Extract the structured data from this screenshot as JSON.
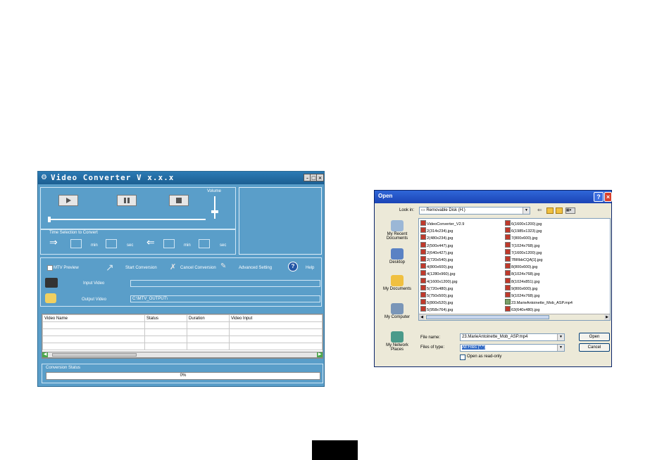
{
  "video_converter": {
    "title": "Video Converter  V x.x.x",
    "volume_label": "Volume",
    "time_section_label": "Time Selection to Convert",
    "start_arrow": "⇒",
    "end_arrow": "⇐",
    "min_label": "min",
    "sec_label": "sec",
    "mtv_preview": "MTV Preview",
    "start_conversion": "Start Conversion",
    "cancel_conversion": "Cancel Conversion",
    "advanced_setting": "Advanced Setting",
    "help": "Help",
    "input_video_label": "Input Video",
    "input_video_value": "",
    "output_video_label": "Output Video",
    "output_video_value": "C:\\MTV_OUTPUT\\",
    "columns": [
      "Video Name",
      "Status",
      "Duration",
      "Video Input"
    ],
    "conversion_status_label": "Conversion Status",
    "progress_text": "0%",
    "progress_value": 0
  },
  "open_dialog": {
    "title": "Open",
    "look_in_label": "Look in:",
    "look_in_value": "Removable Disk (H:)",
    "places": [
      "My Recent Documents",
      "Desktop",
      "My Documents",
      "My Computer",
      "My Network Places"
    ],
    "files_col1": [
      "VideoConverter_V2.9",
      "2(314x234).jpg",
      "2(480x234).jpg",
      "2(500x447).jpg",
      "2(640x427).jpg",
      "2(720x540).jpg",
      "4(800x600).jpg",
      "4(1280x960).jpg",
      "4(1600x1200).jpg",
      "5(720x480).jpg",
      "5(750x500).jpg",
      "5(800x520).jpg",
      "5(958x764).jpg"
    ],
    "files_col2": [
      "6(1600x1200).jpg",
      "6(1985x1323).jpg",
      "7(800x600).jpg",
      "7(1024x768).jpg",
      "7(1600x1200).jpg",
      "7BRbbCQA[1].jpg",
      "8(800x600).jpg",
      "8(1024x768).jpg",
      "8(1024x851).jpg",
      "9(800x600).jpg",
      "9(1024x768).jpg",
      "23.MarieAntoinette_Mob_ASP.mp4",
      "63(640x480).jpg"
    ],
    "file_name_label": "File name:",
    "file_name_value": "23.MarieAntoinette_Mob_ASP.mp4",
    "files_of_type_label": "Files of type:",
    "files_of_type_value": "All Files (*.*)",
    "open_readonly": "Open as read-only",
    "open_button": "Open",
    "cancel_button": "Cancel"
  }
}
